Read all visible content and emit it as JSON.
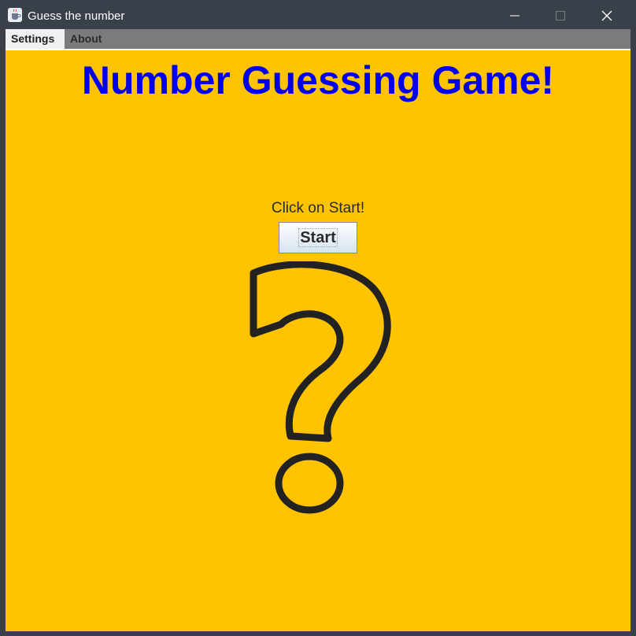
{
  "window": {
    "title": "Guess the number"
  },
  "menu": {
    "items": [
      {
        "label": "Settings"
      },
      {
        "label": "About"
      }
    ]
  },
  "game": {
    "title": "Number Guessing Game!",
    "prompt": "Click on Start!",
    "start_label": "Start"
  },
  "colors": {
    "content_bg": "#ffc300",
    "title_color": "#0000ee",
    "titlebar": "#394049",
    "menubar": "#7b7b7b"
  },
  "icons": {
    "app": "java-coffee-cup-icon",
    "illustration": "question-mark-icon"
  }
}
